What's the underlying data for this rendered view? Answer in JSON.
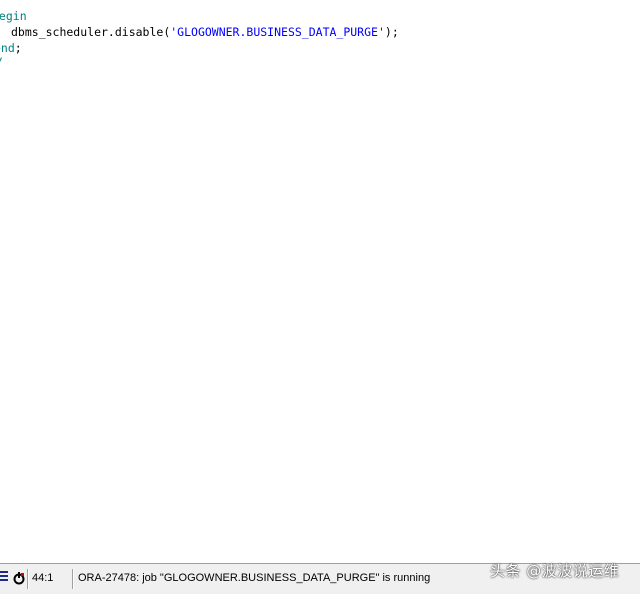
{
  "editor": {
    "lines": [
      {
        "kw": "begin",
        "visible": "gegin"
      },
      {
        "plain_before": "dbms_scheduler.disable(",
        "string": "'GLOGOWNER.BUSINESS_DATA_PURGE'",
        "plain_after": ");"
      },
      {
        "kw": "end",
        "visible": "end",
        "plain_after": ";"
      },
      {
        "kw": "/"
      }
    ],
    "line1_text": "gegin",
    "line2_call": "dbms_scheduler.disable(",
    "line2_arg": "'GLOGOWNER.BUSINESS_DATA_PURGE'",
    "line2_close": ");",
    "line3_kw": "end",
    "line3_semi": ";",
    "line4_kw": "/"
  },
  "status_bar": {
    "cursor_position": "44:1",
    "message": "ORA-27478: job \"GLOGOWNER.BUSINESS_DATA_PURGE\" is running",
    "icons": [
      "lines-icon",
      "power-icon"
    ]
  },
  "watermark": {
    "text": "头条 @波波说运维"
  },
  "colors": {
    "keyword": "#008080",
    "string": "#0000ff",
    "status_icon": "#1b2a8c"
  }
}
